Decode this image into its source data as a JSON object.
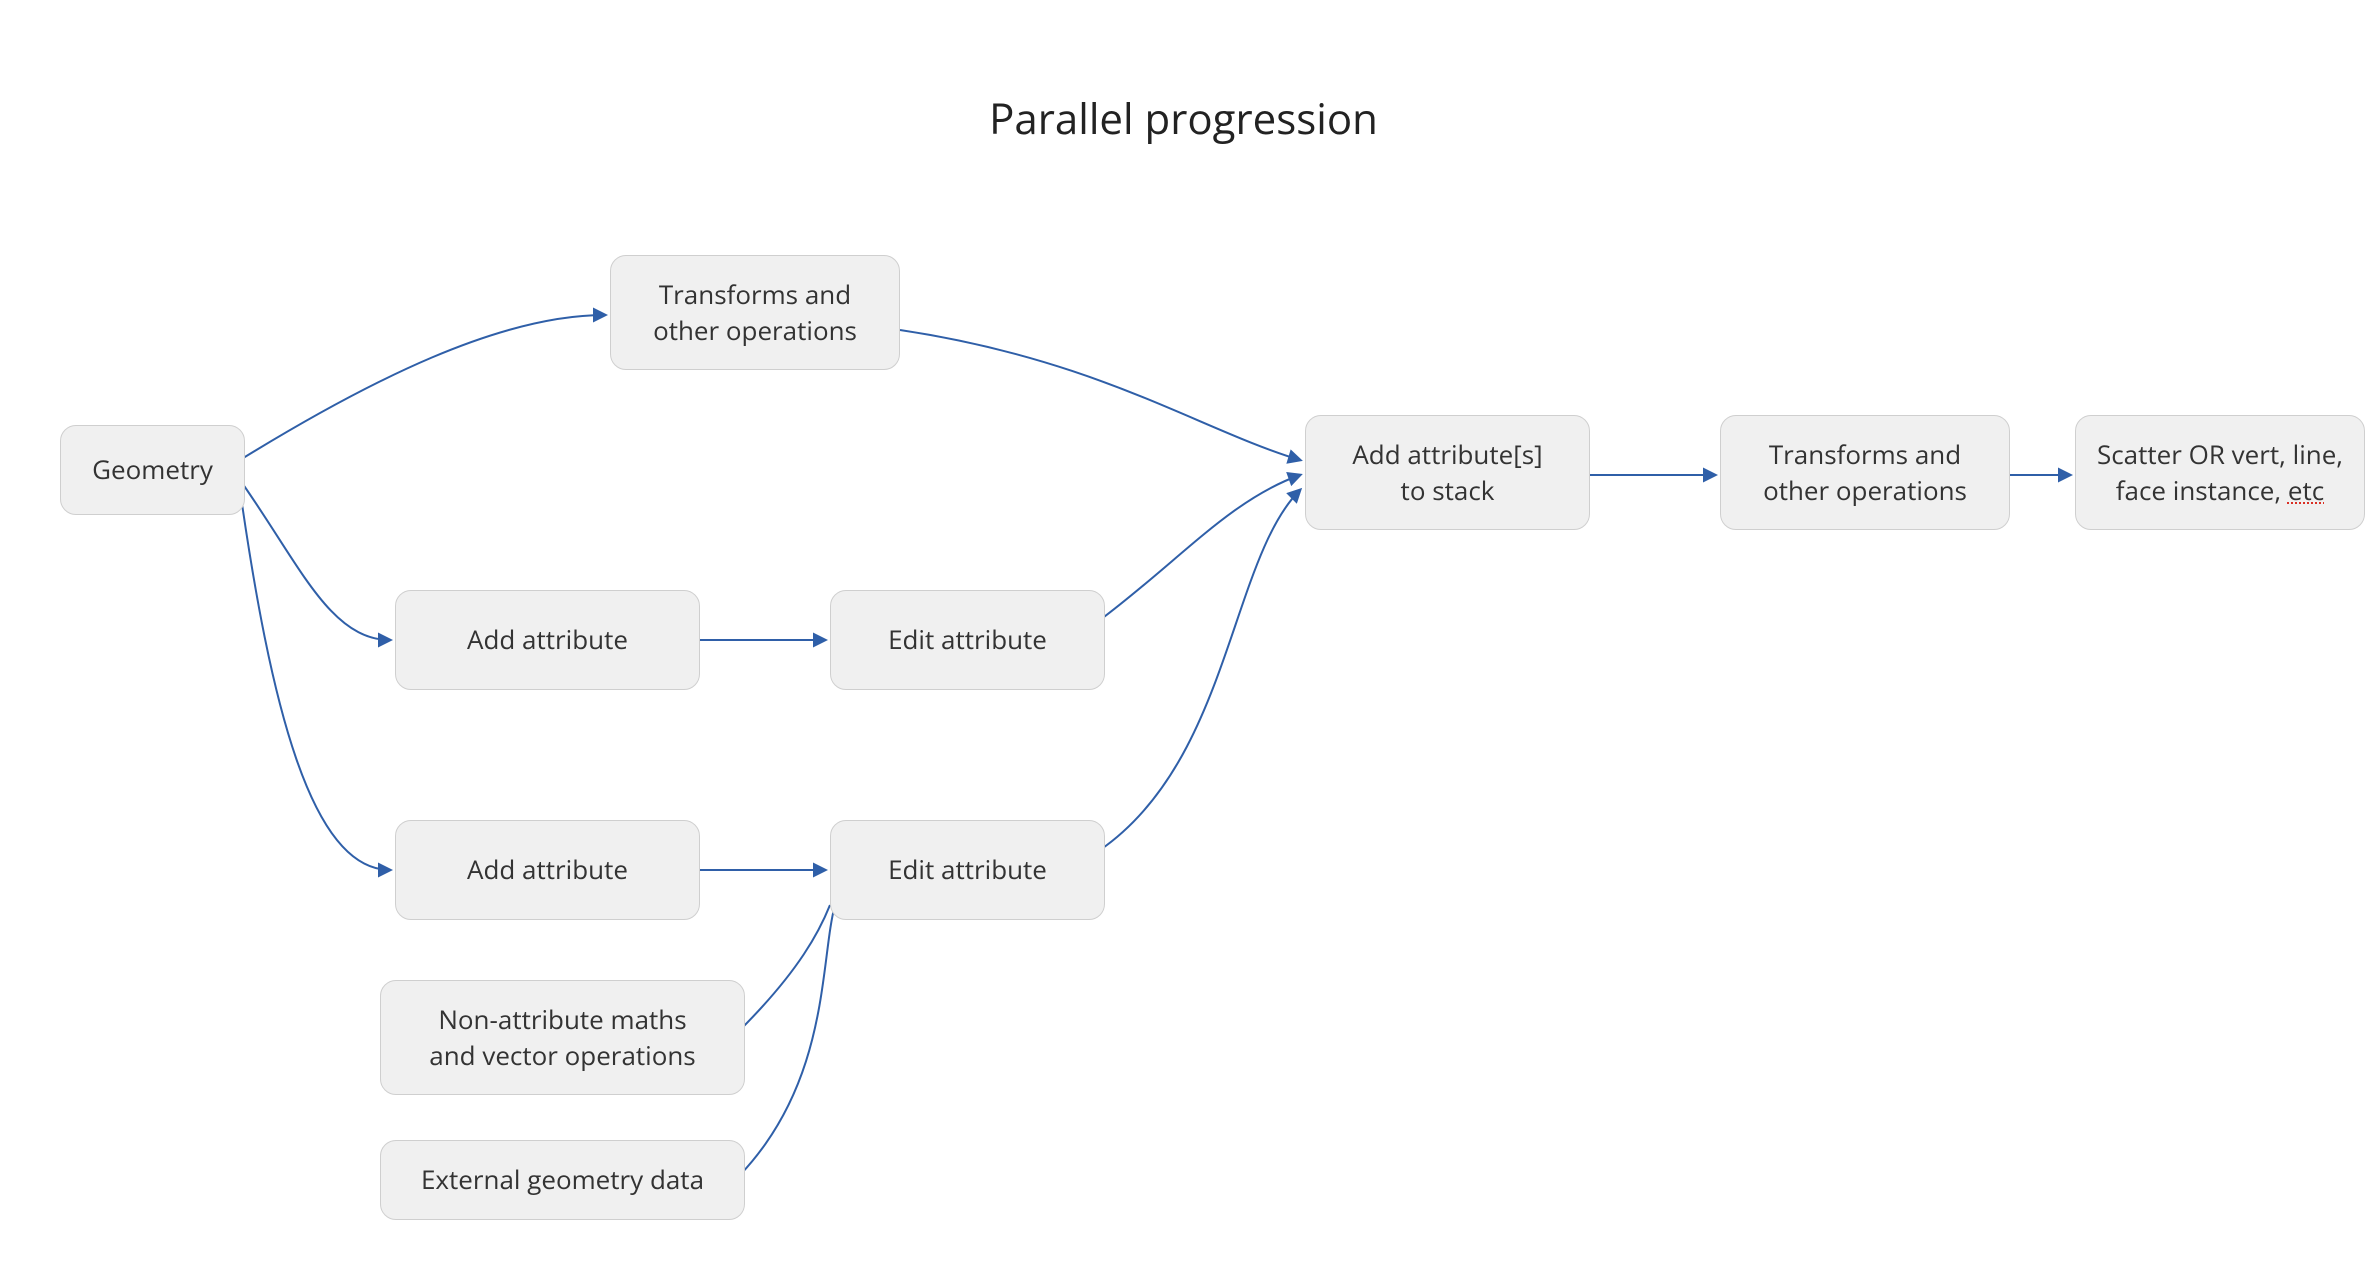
{
  "diagram": {
    "title": "Parallel progression",
    "nodes": {
      "geometry": "Geometry",
      "transforms1_line1": "Transforms and",
      "transforms1_line2": "other operations",
      "add_attr_a": "Add attribute",
      "edit_attr_a": "Edit attribute",
      "add_attr_b": "Add attribute",
      "edit_attr_b": "Edit attribute",
      "non_attr_line1": "Non-attribute maths",
      "non_attr_line2": "and vector operations",
      "ext_geo": "External geometry data",
      "add_attrs_stack_line1": "Add attribute[s]",
      "add_attrs_stack_line2": "to stack",
      "transforms2_line1": "Transforms and",
      "transforms2_line2": "other operations",
      "scatter_line1": "Scatter OR vert, line,",
      "scatter_line2_a": "face instance, ",
      "scatter_line2_b": "etc"
    },
    "edge_color": "#2f5fa8",
    "edge_width": 2
  }
}
